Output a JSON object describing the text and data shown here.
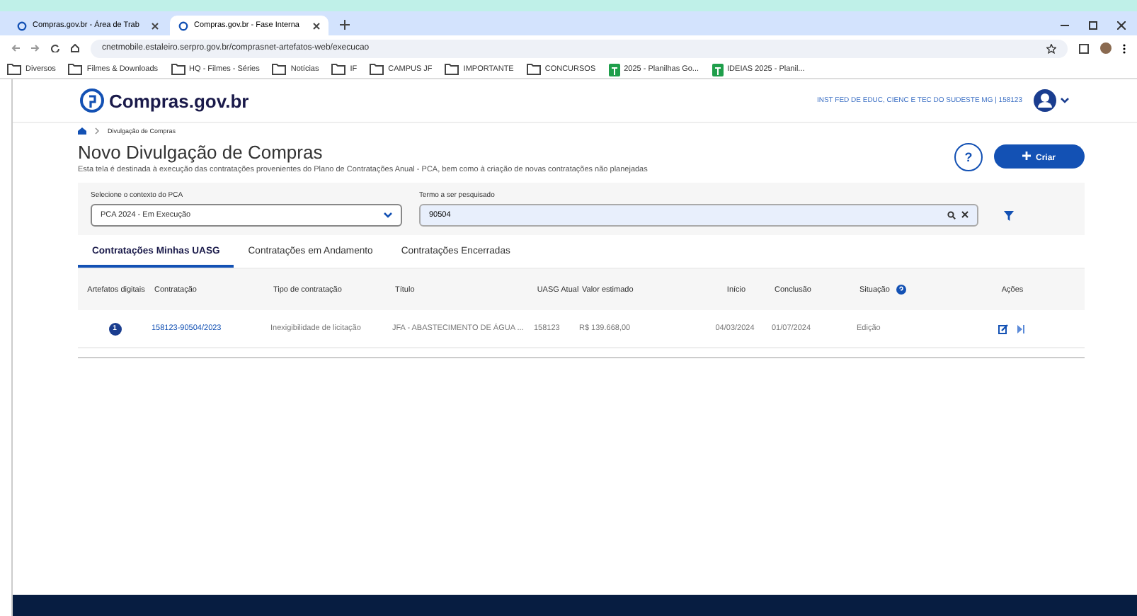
{
  "browser": {
    "tabs": [
      {
        "title": "Compras.gov.br - Área de Trab",
        "selected": false
      },
      {
        "title": "Compras.gov.br - Fase Interna",
        "selected": true
      }
    ],
    "address": "cnetmobile.estaleiro.serpro.gov.br/comprasnet-artefatos-web/execucao",
    "bookmarks": [
      {
        "label": "Diversos",
        "kind": "folder"
      },
      {
        "label": "Filmes & Downloads",
        "kind": "folder"
      },
      {
        "label": "HQ - Filmes - Séries",
        "kind": "folder"
      },
      {
        "label": "Notícias",
        "kind": "folder"
      },
      {
        "label": "IF",
        "kind": "folder"
      },
      {
        "label": "CAMPUS JF",
        "kind": "folder"
      },
      {
        "label": "IMPORTANTE",
        "kind": "folder"
      },
      {
        "label": "CONCURSOS",
        "kind": "folder"
      },
      {
        "label": "2025 - Planilhas Go...",
        "kind": "sheet"
      },
      {
        "label": "IDEIAS 2025 - Planil...",
        "kind": "sheet"
      }
    ]
  },
  "header": {
    "logo": "Compras.gov.br",
    "org": "INST FED DE EDUC, CIENC E TEC DO SUDESTE MG | 158123"
  },
  "breadcrumb": "Divulgação de Compras",
  "page": {
    "title": "Novo Divulgação de Compras",
    "subtitle": "Esta tela é destinada à execução das contratações provenientes do Plano de Contratações Anual - PCA, bem como à criação de novas contratações não planejadas",
    "help": "?",
    "create": "Criar"
  },
  "filters": {
    "context_label": "Selecione o contexto do PCA",
    "context_value": "PCA 2024 - Em Execução",
    "search_label": "Termo a ser pesquisado",
    "search_value": "90504"
  },
  "tabs": [
    {
      "label": "Contratações Minhas UASG",
      "selected": true
    },
    {
      "label": "Contratações em Andamento",
      "selected": false
    },
    {
      "label": "Contratações Encerradas",
      "selected": false
    }
  ],
  "table": {
    "columns": [
      "Artefatos digitais",
      "Contratação",
      "Tipo de contratação",
      "Título",
      "UASG Atual",
      "Valor estimado",
      "Início",
      "Conclusão",
      "Situação",
      "Ações"
    ],
    "rows": [
      {
        "artefatos": "1",
        "contratacao": "158123-90504/2023",
        "tipo": "Inexigibilidade de licitação",
        "titulo": "JFA - ABASTECIMENTO DE ÁGUA ...",
        "uasg": "158123",
        "valor": "R$ 139.668,00",
        "inicio": "04/03/2024",
        "conclusao": "01/07/2024",
        "situacao": "Edição"
      }
    ]
  }
}
